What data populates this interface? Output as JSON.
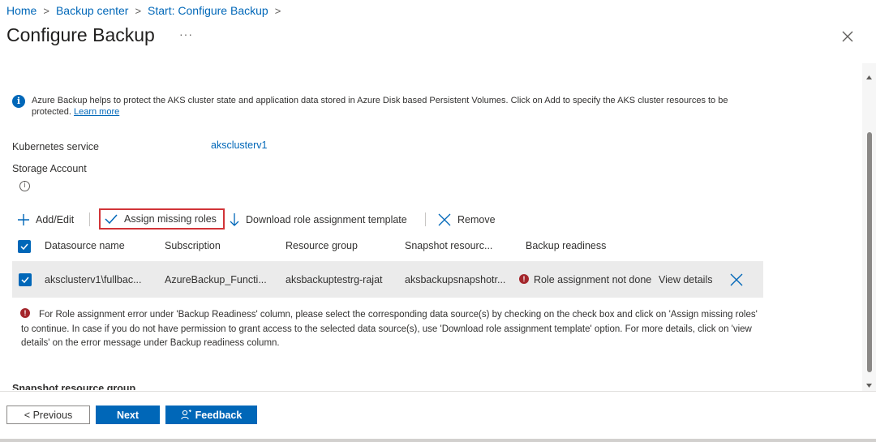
{
  "breadcrumb": {
    "items": [
      "Home",
      "Backup center",
      "Start: Configure Backup"
    ]
  },
  "page": {
    "title": "Configure Backup",
    "more": "···"
  },
  "info": {
    "text": "Azure Backup helps to protect the AKS cluster state and application data stored in Azure Disk based Persistent Volumes. Click on Add to specify the AKS cluster resources to be protected.",
    "link": "Learn more"
  },
  "fields": {
    "kubernetes_label": "Kubernetes service",
    "kubernetes_value": "aksclusterv1",
    "storage_label": "Storage Account"
  },
  "toolbar": {
    "add": "Add/Edit",
    "assign": "Assign missing roles",
    "download": "Download role assignment template",
    "remove": "Remove"
  },
  "table": {
    "headers": [
      "Datasource name",
      "Subscription",
      "Resource group",
      "Snapshot resourc...",
      "Backup readiness"
    ],
    "row": {
      "datasource": "aksclusterv1\\fullbac...",
      "subscription": "AzureBackup_Functi...",
      "resource_group": "aksbackuptestrg-rajat",
      "snapshot": "aksbackupsnapshotr...",
      "readiness": "Role assignment not done",
      "view_details": "View details"
    }
  },
  "error": {
    "text": "For Role assignment error under 'Backup Readiness' column, please select the corresponding data source(s) by checking on the check box and click on 'Assign missing roles' to continue. In case if you do not have permission to grant access to the selected data source(s), use 'Download role assignment template' option. For more details, click on 'view details' on the error message under Backup readiness column."
  },
  "section": {
    "snapshot_rg": "Snapshot resource group"
  },
  "footer": {
    "previous": "< Previous",
    "next": "Next",
    "feedback": "Feedback"
  },
  "colors": {
    "accent": "#0067b8",
    "error": "#a4262c",
    "highlight_border": "#d13438"
  }
}
